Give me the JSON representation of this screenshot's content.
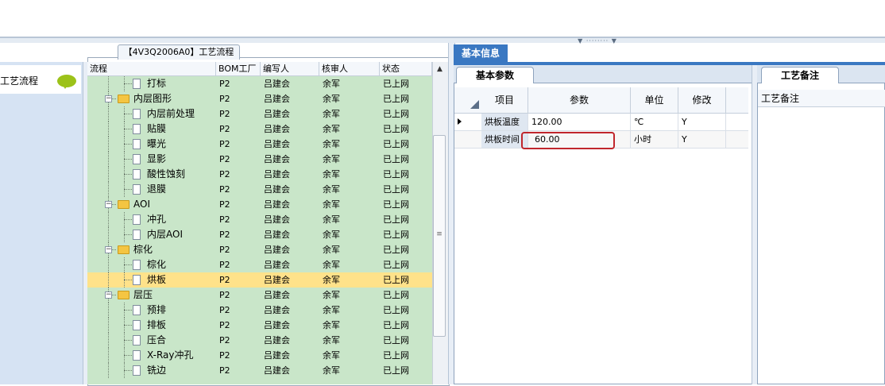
{
  "left_panel": {
    "title": "工艺流程"
  },
  "tree": {
    "tab_title": "【4V3Q2006A0】工艺流程",
    "columns": [
      "流程",
      "BOM工厂",
      "编写人",
      "核审人",
      "状态"
    ],
    "rows": [
      {
        "name": "打标",
        "level": 2,
        "folder": false,
        "expanded": false,
        "bom": "P2",
        "writer": "吕建会",
        "reviewer": "余军",
        "status": "已上网",
        "selected": false
      },
      {
        "name": "内层图形",
        "level": 1,
        "folder": true,
        "expanded": true,
        "bom": "P2",
        "writer": "吕建会",
        "reviewer": "余军",
        "status": "已上网",
        "selected": false
      },
      {
        "name": "内层前处理",
        "level": 2,
        "folder": false,
        "expanded": false,
        "bom": "P2",
        "writer": "吕建会",
        "reviewer": "余军",
        "status": "已上网",
        "selected": false
      },
      {
        "name": "贴膜",
        "level": 2,
        "folder": false,
        "expanded": false,
        "bom": "P2",
        "writer": "吕建会",
        "reviewer": "余军",
        "status": "已上网",
        "selected": false
      },
      {
        "name": "曝光",
        "level": 2,
        "folder": false,
        "expanded": false,
        "bom": "P2",
        "writer": "吕建会",
        "reviewer": "余军",
        "status": "已上网",
        "selected": false
      },
      {
        "name": "显影",
        "level": 2,
        "folder": false,
        "expanded": false,
        "bom": "P2",
        "writer": "吕建会",
        "reviewer": "余军",
        "status": "已上网",
        "selected": false
      },
      {
        "name": "酸性蚀刻",
        "level": 2,
        "folder": false,
        "expanded": false,
        "bom": "P2",
        "writer": "吕建会",
        "reviewer": "余军",
        "status": "已上网",
        "selected": false
      },
      {
        "name": "退膜",
        "level": 2,
        "folder": false,
        "expanded": false,
        "bom": "P2",
        "writer": "吕建会",
        "reviewer": "余军",
        "status": "已上网",
        "selected": false
      },
      {
        "name": "AOI",
        "level": 1,
        "folder": true,
        "expanded": true,
        "bom": "P2",
        "writer": "吕建会",
        "reviewer": "余军",
        "status": "已上网",
        "selected": false
      },
      {
        "name": "冲孔",
        "level": 2,
        "folder": false,
        "expanded": false,
        "bom": "P2",
        "writer": "吕建会",
        "reviewer": "余军",
        "status": "已上网",
        "selected": false
      },
      {
        "name": "内层AOI",
        "level": 2,
        "folder": false,
        "expanded": false,
        "bom": "P2",
        "writer": "吕建会",
        "reviewer": "余军",
        "status": "已上网",
        "selected": false
      },
      {
        "name": "棕化",
        "level": 1,
        "folder": true,
        "expanded": true,
        "bom": "P2",
        "writer": "吕建会",
        "reviewer": "余军",
        "status": "已上网",
        "selected": false
      },
      {
        "name": "棕化",
        "level": 2,
        "folder": false,
        "expanded": false,
        "bom": "P2",
        "writer": "吕建会",
        "reviewer": "余军",
        "status": "已上网",
        "selected": false
      },
      {
        "name": "烘板",
        "level": 2,
        "folder": false,
        "expanded": false,
        "bom": "P2",
        "writer": "吕建会",
        "reviewer": "余军",
        "status": "已上网",
        "selected": true
      },
      {
        "name": "层压",
        "level": 1,
        "folder": true,
        "expanded": true,
        "bom": "P2",
        "writer": "吕建会",
        "reviewer": "余军",
        "status": "已上网",
        "selected": false
      },
      {
        "name": "预排",
        "level": 2,
        "folder": false,
        "expanded": false,
        "bom": "P2",
        "writer": "吕建会",
        "reviewer": "余军",
        "status": "已上网",
        "selected": false
      },
      {
        "name": "排板",
        "level": 2,
        "folder": false,
        "expanded": false,
        "bom": "P2",
        "writer": "吕建会",
        "reviewer": "余军",
        "status": "已上网",
        "selected": false
      },
      {
        "name": "压合",
        "level": 2,
        "folder": false,
        "expanded": false,
        "bom": "P2",
        "writer": "吕建会",
        "reviewer": "余军",
        "status": "已上网",
        "selected": false
      },
      {
        "name": "X-Ray冲孔",
        "level": 2,
        "folder": false,
        "expanded": false,
        "bom": "P2",
        "writer": "吕建会",
        "reviewer": "余军",
        "status": "已上网",
        "selected": false
      },
      {
        "name": "铣边",
        "level": 2,
        "folder": false,
        "expanded": false,
        "bom": "P2",
        "writer": "吕建会",
        "reviewer": "余军",
        "status": "已上网",
        "selected": false
      }
    ]
  },
  "info": {
    "tab_title": "基本信息",
    "params_tab": "基本参数",
    "params_columns": [
      "项目",
      "参数",
      "单位",
      "修改"
    ],
    "params_rows": [
      {
        "item": "烘板温度",
        "value": "120.00",
        "unit": "℃",
        "modify": "Y"
      },
      {
        "item": "烘板时间",
        "value": "60.00",
        "unit": "小时",
        "modify": "Y"
      }
    ],
    "notes_tab": "工艺备注",
    "notes_header": "工艺备注"
  },
  "colors": {
    "tree_bg": "#c9e6c9",
    "selected_row": "#ffe28a",
    "tab_active": "#3a78c2",
    "highlight_box": "#c0262c",
    "bubble": "#9cc219"
  }
}
